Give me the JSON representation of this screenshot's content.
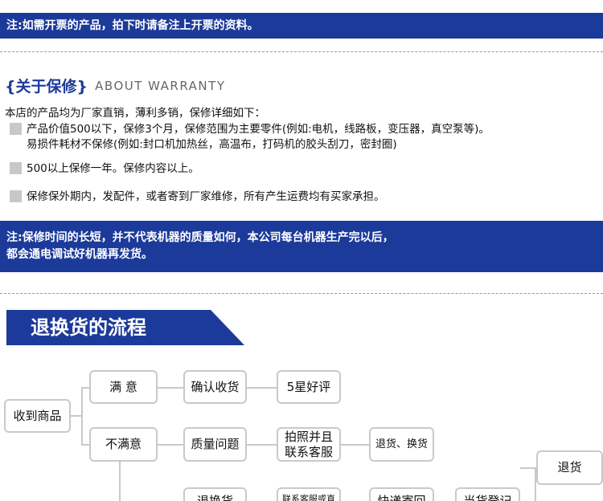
{
  "notice_top": "注:如需开票的产品，拍下时请备注上开票的资料。",
  "warranty": {
    "title_cn": "{关于保修}",
    "title_en": "ABOUT WARRANTY",
    "intro": "本店的产品均为厂家直销，薄利多销，保修详细如下：",
    "items": [
      {
        "line1": "产品价值500以下，保修3个月，保修范围为主要零件(例如:电机，线路板，变压器，真空泵等)。",
        "line2": "易损件耗材不保修(例如:封口机加热丝，高温布，打码机的胶头刮刀，密封圈)"
      },
      {
        "line1": "500以上保修一年。保修内容以上。"
      },
      {
        "line1": "保修保外期内，发配件，或者寄到厂家维修，所有产生运费均有买家承担。"
      }
    ]
  },
  "notice_bottom": {
    "line1": "注:保修时间的长短，并不代表机器的质量如何，本公司每台机器生产完以后，",
    "line2": "都会通电调试好机器再发货。"
  },
  "flow": {
    "title": "退换货的流程",
    "nodes": {
      "receive": "收到商品",
      "satisfied": "满 意",
      "confirm": "确认收货",
      "five_star": "5星好评",
      "unsatisfied": "不满意",
      "quality": "质量问题",
      "photo": "拍照并且\n联系客服",
      "return_exchange": "退货、换货",
      "return": "退货",
      "partial_1": "退换货",
      "partial_2": "联系客服或直",
      "partial_3": "快递寄回",
      "partial_4": "当货登记"
    }
  },
  "colors": {
    "brand_blue": "#1c3a9a",
    "box_border": "#c9c9c9",
    "bullet_gray": "#c8c8c8"
  }
}
